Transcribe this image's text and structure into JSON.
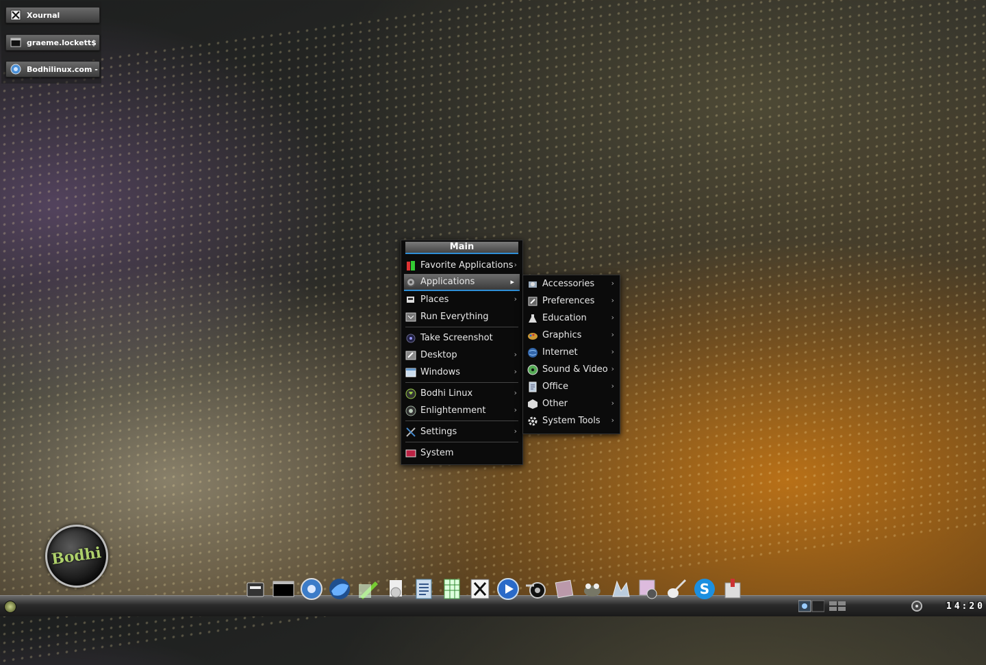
{
  "iconified_windows": [
    {
      "label": "Xournal",
      "icon": "xournal-icon"
    },
    {
      "label": "graeme.lockett$",
      "icon": "terminal-icon"
    },
    {
      "label": "Bodhilinux.com - Ch",
      "icon": "chromium-icon"
    }
  ],
  "desktop": {
    "logo_text": "Bodhi"
  },
  "main_menu": {
    "title": "Main",
    "items": [
      {
        "label": "Favorite Applications",
        "icon": "favorite-apps-icon",
        "submenu": true
      },
      {
        "label": "Applications",
        "icon": "applications-icon",
        "submenu": true,
        "selected": true
      },
      {
        "label": "Places",
        "icon": "places-icon",
        "submenu": true
      },
      {
        "label": "Run Everything",
        "icon": "run-everything-icon",
        "submenu": false
      },
      {
        "label": "Take Screenshot",
        "icon": "screenshot-icon",
        "submenu": false
      },
      {
        "label": "Desktop",
        "icon": "desktop-icon",
        "submenu": true
      },
      {
        "label": "Windows",
        "icon": "windows-icon",
        "submenu": true
      },
      {
        "label": "Bodhi Linux",
        "icon": "bodhi-icon",
        "submenu": true
      },
      {
        "label": "Enlightenment",
        "icon": "enlightenment-icon",
        "submenu": true
      },
      {
        "label": "Settings",
        "icon": "settings-icon",
        "submenu": true
      },
      {
        "label": "System",
        "icon": "system-icon",
        "submenu": false
      }
    ]
  },
  "applications_submenu": {
    "items": [
      {
        "label": "Accessories",
        "icon": "accessories-icon"
      },
      {
        "label": "Preferences",
        "icon": "preferences-icon"
      },
      {
        "label": "Education",
        "icon": "education-icon"
      },
      {
        "label": "Graphics",
        "icon": "graphics-icon"
      },
      {
        "label": "Internet",
        "icon": "internet-icon"
      },
      {
        "label": "Sound & Video",
        "icon": "sound-video-icon"
      },
      {
        "label": "Office",
        "icon": "office-icon"
      },
      {
        "label": "Other",
        "icon": "other-icon"
      },
      {
        "label": "System Tools",
        "icon": "system-tools-icon"
      }
    ]
  },
  "dock_icons": [
    "file-manager-icon",
    "terminal-icon",
    "chromium-icon",
    "firefox-icon",
    "text-editor-icon",
    "disk-utility-icon",
    "word-processor-icon",
    "spreadsheet-icon",
    "xournal-icon",
    "media-player-icon",
    "blender-icon",
    "image-viewer-icon",
    "gimp-icon",
    "inkscape-icon",
    "webcam-icon",
    "guitar-icon",
    "skype-icon",
    "archive-icon"
  ],
  "clock": {
    "h1": "1",
    "h2": "4",
    "m1": "2",
    "m2": "0"
  },
  "colors": {
    "accent": "#2f8fd8",
    "menu_bg": "#0b0b0b"
  }
}
